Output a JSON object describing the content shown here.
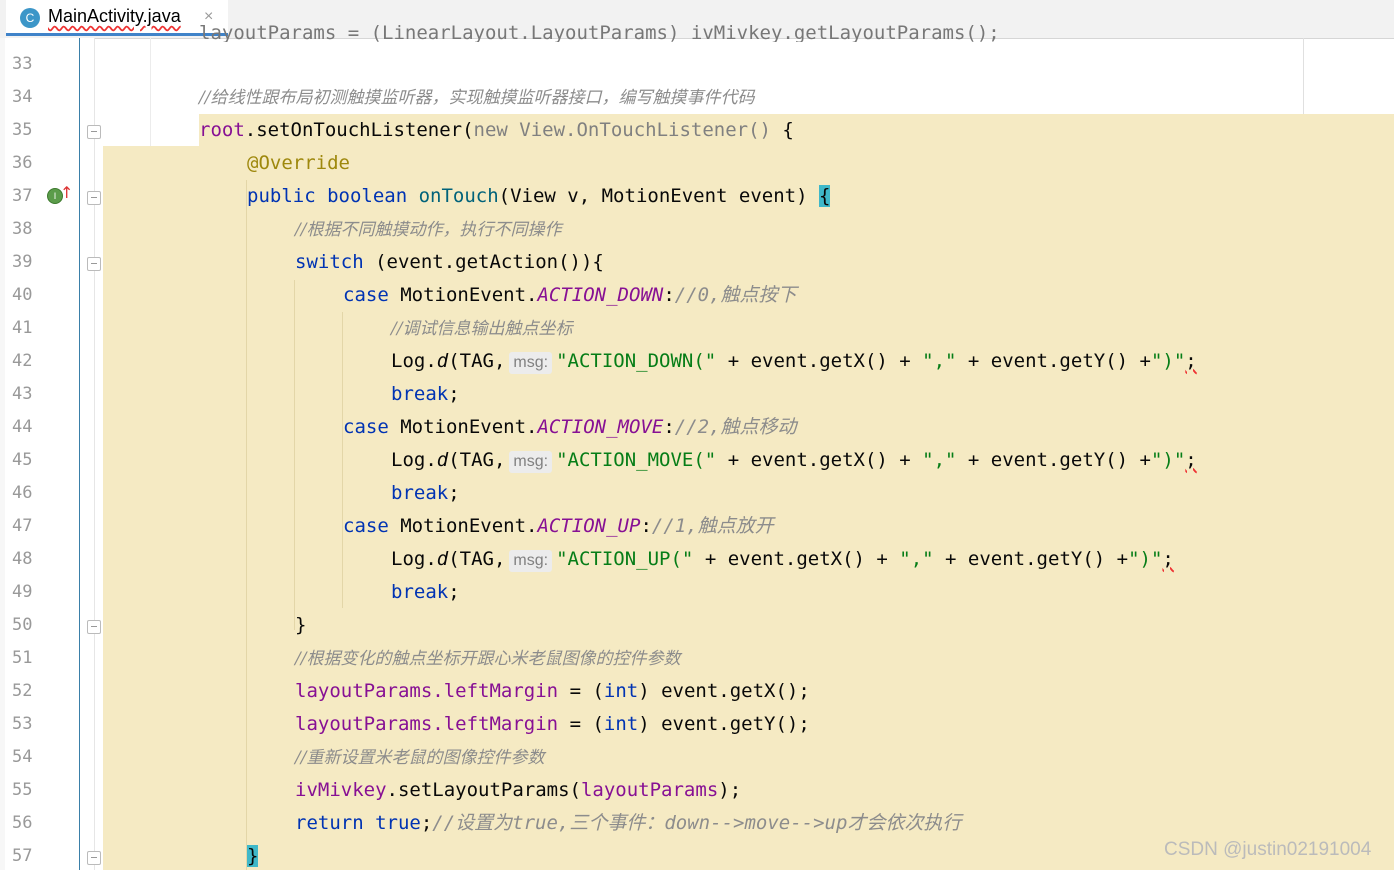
{
  "tab": {
    "icon_letter": "C",
    "filename": "MainActivity.java",
    "close_glyph": "×"
  },
  "partial_top_line": "layoutParams = (LinearLayout.LayoutParams) ivMivkey.getLayoutParams();",
  "line_numbers": [
    "33",
    "34",
    "35",
    "36",
    "37",
    "38",
    "39",
    "40",
    "41",
    "42",
    "43",
    "44",
    "45",
    "46",
    "47",
    "48",
    "49",
    "50",
    "51",
    "52",
    "53",
    "54",
    "55",
    "56",
    "57"
  ],
  "code": {
    "c34": "//给线性跟布局初测触摸监听器，实现触摸监听器接口，编写触摸事件代码",
    "c35_a": "root",
    "c35_b": ".setOnTouchListener(",
    "c35_c": "new View.OnTouchListener()",
    "c35_d": " {",
    "c36": "@Override",
    "c37_a": "public boolean ",
    "c37_b": "onTouch",
    "c37_c": "(View v, MotionEvent event) ",
    "c37_d": "{",
    "c38": "//根据不同触摸动作，执行不同操作",
    "c39_a": "switch",
    "c39_b": " (event.getAction()){",
    "c40_a": "case",
    "c40_b": " MotionEvent.",
    "c40_c": "ACTION_DOWN",
    "c40_d": ":",
    "c40_e": "//0,触点按下",
    "c41": "//调试信息输出触点坐标",
    "log": "Log.",
    "d": "d",
    "tag_open": "(TAG,",
    "hint": "msg:",
    "c42_s1": "\"ACTION_DOWN(\"",
    "c42_m": " + event.getX() + ",
    "c42_s2": "\",\"",
    "c42_m2": " + event.getY() +",
    "c42_s3": "\")\"",
    "semi": ";",
    "brk": "break",
    "c44_a": "case",
    "c44_b": " MotionEvent.",
    "c44_c": "ACTION_MOVE",
    "c44_d": ":",
    "c44_e": "//2,触点移动",
    "c45_s1": "\"ACTION_MOVE(\"",
    "c47_a": "case",
    "c47_b": " MotionEvent.",
    "c47_c": "ACTION_UP",
    "c47_d": ":",
    "c47_e": "//1,触点放开",
    "c48_s1": "\"ACTION_UP(\"",
    "c50": "}",
    "c51": "//根据变化的触点坐标开跟心米老鼠图像的控件参数",
    "lp": "layoutParams",
    "lm": ".leftMargin",
    "eq": " = (",
    "int": "int",
    "gx": ") event.getX();",
    "gy": ") event.getY();",
    "c54": "//重新设置米老鼠的图像控件参数",
    "c55_a": "ivMivkey",
    "c55_b": ".setLayoutParams(",
    "c55_c": "layoutParams",
    "c55_d": ");",
    "c56_a": "return",
    "c56_b": " true",
    "c56_c": ";",
    "c56_d": "//设置为true,三个事件：down-->move-->up才会依次执行",
    "c57": "}"
  },
  "gutter_icons": [
    "override-implemented-icon",
    "fold-icon"
  ],
  "watermark": "CSDN @justin02191004"
}
